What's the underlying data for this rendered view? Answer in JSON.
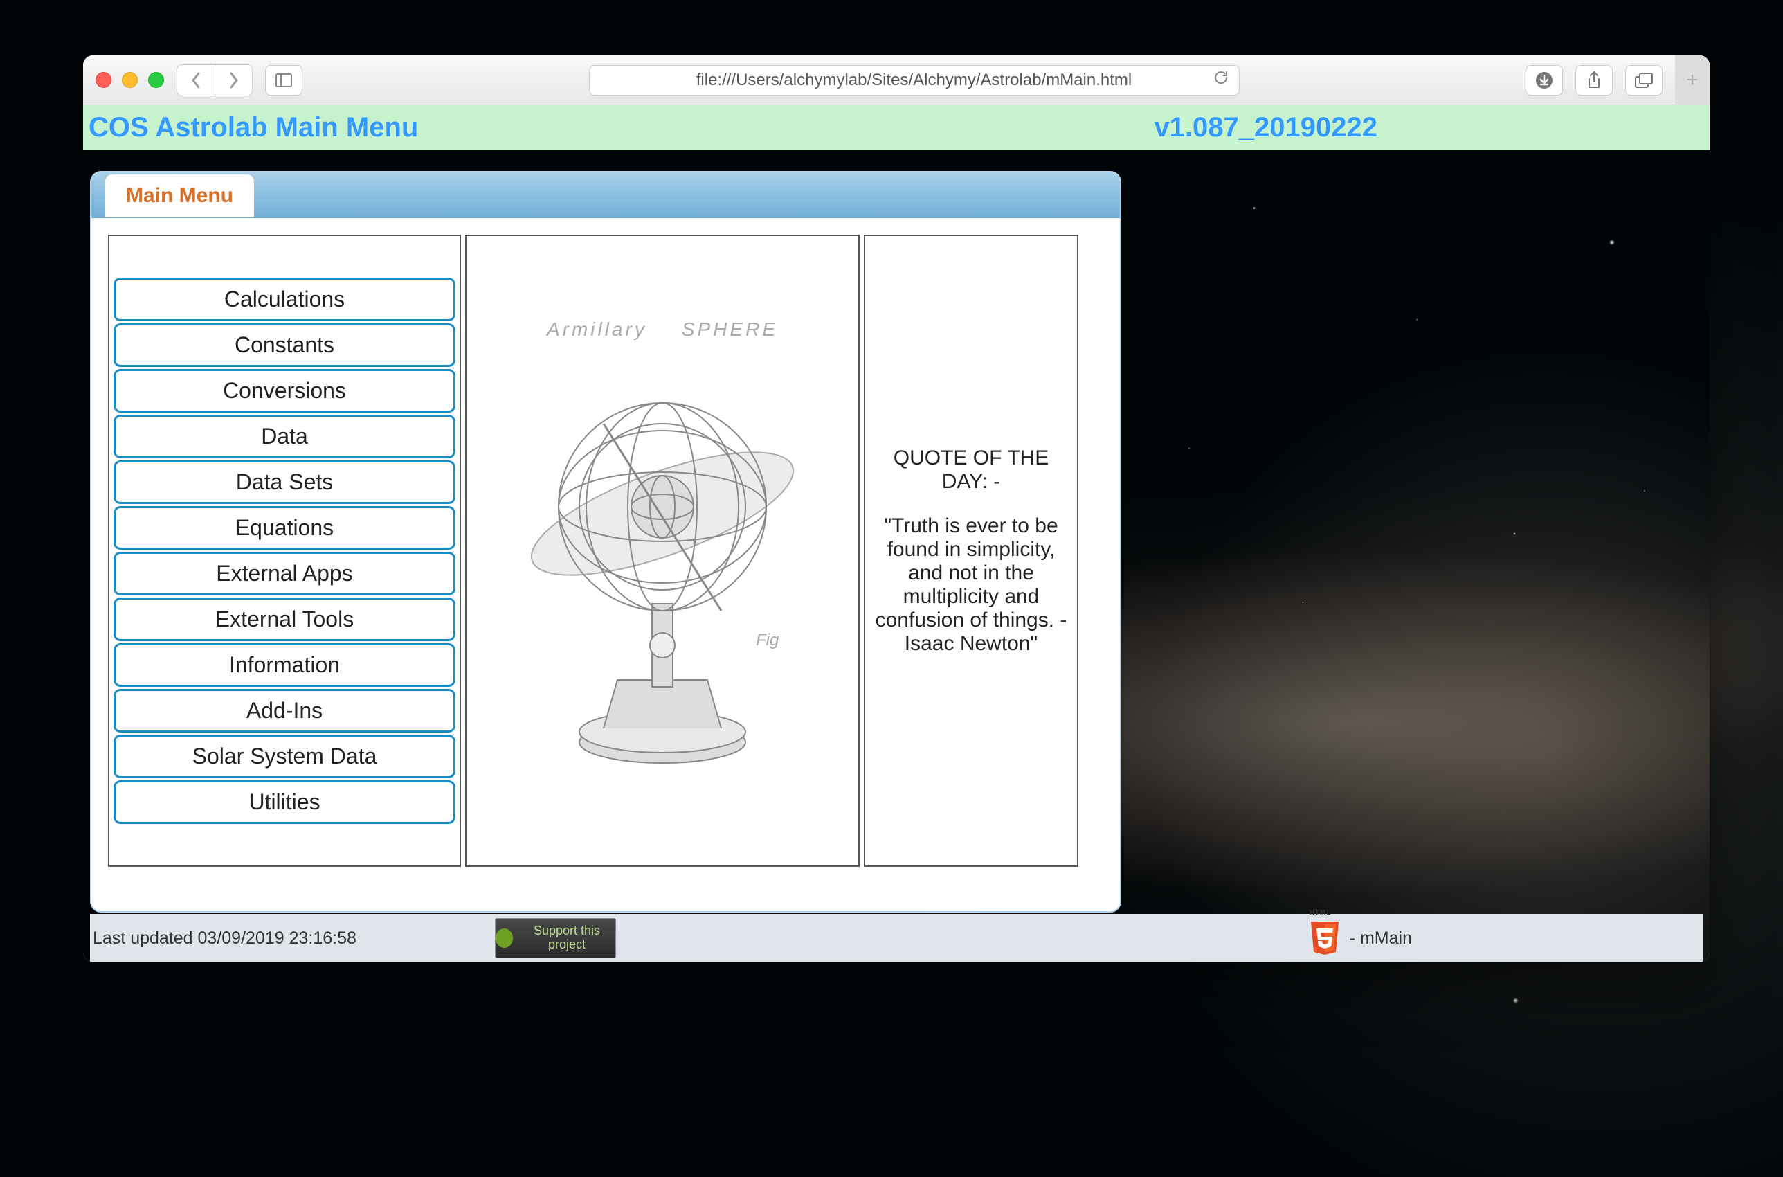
{
  "browser": {
    "url": "file:///Users/alchymylab/Sites/Alchymy/Astrolab/mMain.html"
  },
  "header": {
    "title": "COS Astrolab Main Menu",
    "version": "v1.087_20190222"
  },
  "tab": {
    "label": "Main Menu"
  },
  "menu": {
    "buttons": [
      "Calculations",
      "Constants",
      "Conversions",
      "Data",
      "Data Sets",
      "Equations",
      "External Apps",
      "External Tools",
      "Information",
      "Add-Ins",
      "Solar System Data",
      "Utilities"
    ]
  },
  "illustration": {
    "caption_left": "Armillary",
    "caption_right": "SPHERE"
  },
  "quote": {
    "heading": "QUOTE OF THE DAY: -",
    "body": "\"Truth is ever to be found in simplicity, and not in the multiplicity and confusion of things. - Isaac Newton\""
  },
  "footer": {
    "updated": "Last updated 03/09/2019 23:16:58",
    "support_label": "Support this project",
    "page_name": "- mMain"
  }
}
